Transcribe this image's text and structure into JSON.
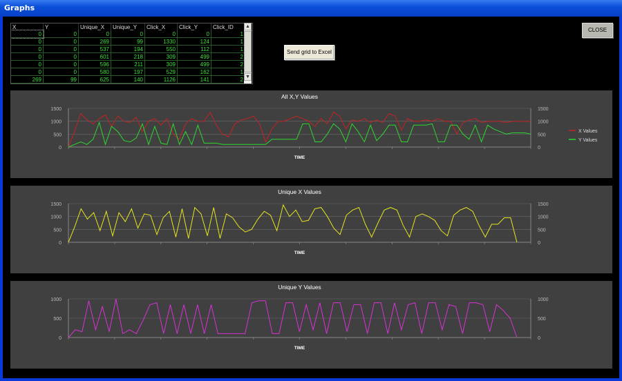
{
  "window": {
    "title": "Graphs"
  },
  "grid": {
    "columns": [
      "X",
      "Y",
      "Unique_X",
      "Unique_Y",
      "Click_X",
      "Click_Y",
      "Click_ID"
    ],
    "rows": [
      [
        "0",
        "0",
        "0",
        "0",
        "0",
        "0",
        "1"
      ],
      [
        "0",
        "0",
        "269",
        "99",
        "1330",
        "124",
        "1"
      ],
      [
        "0",
        "0",
        "537",
        "194",
        "550",
        "112",
        "1"
      ],
      [
        "0",
        "0",
        "601",
        "218",
        "309",
        "499",
        "2"
      ],
      [
        "0",
        "0",
        "596",
        "211",
        "309",
        "499",
        "2"
      ],
      [
        "0",
        "0",
        "580",
        "197",
        "529",
        "162",
        "1"
      ],
      [
        "269",
        "99",
        "625",
        "140",
        "1126",
        "141",
        "2"
      ]
    ]
  },
  "buttons": {
    "excel": "Send grid to Excel",
    "close": "CLOSE"
  },
  "colors": {
    "x": "#c82222",
    "y": "#2ed82e",
    "ux": "#e6e620",
    "uy": "#d832d8"
  },
  "chart_data": [
    {
      "type": "line",
      "title": "All  X,Y Values",
      "xlabel": "TIME",
      "ylim": [
        0,
        1500
      ],
      "yticks": [
        "0",
        "500",
        "1000",
        "1500"
      ],
      "legend": "right",
      "series": [
        {
          "name": "X Values",
          "color": "#c82222",
          "values": [
            0,
            600,
            1300,
            1050,
            900,
            1100,
            1250,
            800,
            1200,
            1000,
            950,
            1150,
            600,
            1000,
            1100,
            850,
            1100,
            500,
            300,
            900,
            1100,
            1000,
            1000,
            1350,
            850,
            500,
            400,
            900,
            1050,
            1100,
            1200,
            900,
            200,
            700,
            1000,
            1000,
            1100,
            1200,
            1100,
            1000,
            800,
            1100,
            900,
            1350,
            1200,
            700,
            1050,
            1000,
            1100,
            950,
            1050,
            950,
            1300,
            1200,
            650,
            1100,
            1000,
            1000,
            1050,
            1000,
            1100,
            1000,
            1000,
            500,
            950,
            1050,
            1100,
            950,
            1000,
            1000,
            1000,
            950,
            1000,
            1000,
            1000,
            1000
          ]
        },
        {
          "name": "Y Values",
          "color": "#2ed82e",
          "values": [
            0,
            100,
            200,
            100,
            300,
            950,
            100,
            800,
            600,
            250,
            200,
            350,
            900,
            100,
            800,
            150,
            100,
            900,
            100,
            600,
            100,
            850,
            150,
            150,
            150,
            100,
            100,
            100,
            100,
            100,
            100,
            100,
            100,
            300,
            300,
            300,
            300,
            300,
            900,
            900,
            200,
            200,
            500,
            900,
            700,
            200,
            900,
            600,
            200,
            850,
            250,
            500,
            850,
            850,
            200,
            200,
            850,
            850,
            850,
            900,
            200,
            200,
            850,
            850,
            500,
            300,
            850,
            200,
            850,
            700,
            600,
            500,
            550,
            550,
            550,
            500
          ]
        }
      ]
    },
    {
      "type": "line",
      "title": "Unique X Values",
      "xlabel": "TIME",
      "ylim": [
        0,
        1500
      ],
      "yticks": [
        "0",
        "500",
        "1000",
        "1500"
      ],
      "series": [
        {
          "color": "#e6e620",
          "values": [
            0,
            600,
            1300,
            900,
            1150,
            450,
            1200,
            250,
            1150,
            800,
            1300,
            550,
            1100,
            1050,
            300,
            950,
            1200,
            200,
            1300,
            150,
            1350,
            1100,
            250,
            1350,
            150,
            1100,
            950,
            600,
            400,
            500,
            900,
            1200,
            1050,
            450,
            1450,
            1000,
            1250,
            800,
            850,
            1300,
            1350,
            1000,
            550,
            300,
            1050,
            1250,
            1350,
            700,
            200,
            750,
            1250,
            1350,
            1250,
            650,
            200,
            1000,
            1100,
            1000,
            850,
            450,
            250,
            1050,
            1250,
            1350,
            1200,
            650,
            200,
            700,
            700,
            950,
            950,
            0
          ]
        }
      ]
    },
    {
      "type": "line",
      "title": "Unique Y Values",
      "xlabel": "TIME",
      "ylim": [
        0,
        1000
      ],
      "yticks": [
        "0",
        "500",
        "1000"
      ],
      "series": [
        {
          "color": "#d832d8",
          "values": [
            0,
            200,
            150,
            950,
            200,
            800,
            150,
            1000,
            100,
            200,
            100,
            450,
            850,
            900,
            100,
            850,
            100,
            850,
            100,
            850,
            100,
            850,
            100,
            100,
            100,
            100,
            100,
            900,
            950,
            950,
            100,
            100,
            900,
            900,
            150,
            850,
            200,
            900,
            100,
            900,
            900,
            150,
            850,
            850,
            100,
            900,
            900,
            100,
            900,
            200,
            850,
            900,
            100,
            900,
            900,
            200,
            850,
            800,
            100,
            900,
            900,
            850,
            150,
            850,
            700,
            500,
            0
          ]
        }
      ]
    }
  ]
}
